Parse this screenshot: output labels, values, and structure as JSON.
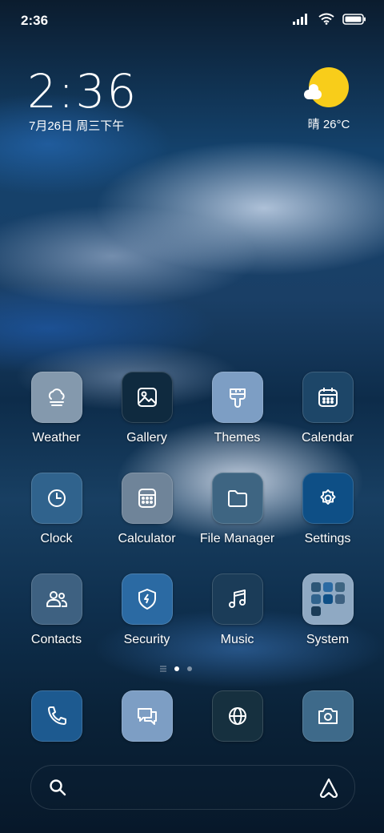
{
  "status_bar": {
    "time": "2:36"
  },
  "clock_widget": {
    "time": "2:36",
    "date": "7月26日 周三下午"
  },
  "weather_widget": {
    "condition": "晴",
    "temperature": "26°C",
    "sun_color": "#f8cd1a"
  },
  "apps": [
    {
      "label": "Weather",
      "icon": "weather-icon",
      "tile": "#8499ad"
    },
    {
      "label": "Gallery",
      "icon": "gallery-icon",
      "tile": "#0f2a3f"
    },
    {
      "label": "Themes",
      "icon": "themes-icon",
      "tile": "#7d9ec4"
    },
    {
      "label": "Calendar",
      "icon": "calendar-icon",
      "tile": "#1d4668"
    },
    {
      "label": "Clock",
      "icon": "clock-icon",
      "tile": "#30638d"
    },
    {
      "label": "Calculator",
      "icon": "calculator-icon",
      "tile": "#6f8499"
    },
    {
      "label": "File Manager",
      "icon": "folder-icon",
      "tile": "#3e6582"
    },
    {
      "label": "Settings",
      "icon": "gear-icon",
      "tile": "#0e4f86"
    },
    {
      "label": "Contacts",
      "icon": "contacts-icon",
      "tile": "#3e6181"
    },
    {
      "label": "Security",
      "icon": "shield-icon",
      "tile": "#2b6aa3"
    },
    {
      "label": "Music",
      "icon": "music-icon",
      "tile": "#1b3c58"
    },
    {
      "label": "System",
      "icon": "folder-grid-icon",
      "tile": "#8fa9c3"
    }
  ],
  "dock": [
    {
      "name": "phone",
      "icon": "phone-icon",
      "tile": "#1d5a90"
    },
    {
      "name": "messages",
      "icon": "messages-icon",
      "tile": "#7d9ec4"
    },
    {
      "name": "browser",
      "icon": "globe-icon",
      "tile": "#16303f"
    },
    {
      "name": "camera",
      "icon": "camera-icon",
      "tile": "#3e6a8a"
    }
  ],
  "search_bar": {
    "icon": "search-icon",
    "assistant_icon": "assistant-icon"
  },
  "pager": {
    "pages": 2,
    "current": 1
  }
}
